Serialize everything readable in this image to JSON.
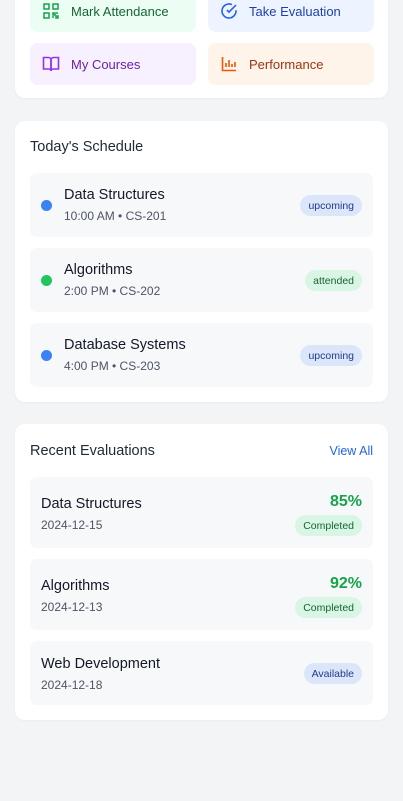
{
  "quick_actions": [
    {
      "label": "Mark Attendance",
      "icon": "qr-code-icon"
    },
    {
      "label": "Take Evaluation",
      "icon": "check-circle-icon"
    },
    {
      "label": "My Courses",
      "icon": "book-open-icon"
    },
    {
      "label": "Performance",
      "icon": "bar-chart-icon"
    }
  ],
  "schedule": {
    "title": "Today's Schedule",
    "items": [
      {
        "name": "Data Structures",
        "meta": "10:00 AM • CS-201",
        "status": "upcoming",
        "dot_color": "#3b82f6"
      },
      {
        "name": "Algorithms",
        "meta": "2:00 PM • CS-202",
        "status": "attended",
        "dot_color": "#22c55e"
      },
      {
        "name": "Database Systems",
        "meta": "4:00 PM • CS-203",
        "status": "upcoming",
        "dot_color": "#3b82f6"
      }
    ]
  },
  "evaluations": {
    "title": "Recent Evaluations",
    "view_all": "View All",
    "items": [
      {
        "name": "Data Structures",
        "date": "2024-12-15",
        "score": "85%",
        "status": "Completed"
      },
      {
        "name": "Algorithms",
        "date": "2024-12-13",
        "score": "92%",
        "status": "Completed"
      },
      {
        "name": "Web Development",
        "date": "2024-12-18",
        "status": "Available"
      }
    ]
  },
  "colors": {
    "accent": "#2563eb",
    "success": "#16a34a",
    "info_dot": "#3b82f6",
    "success_dot": "#22c55e"
  }
}
